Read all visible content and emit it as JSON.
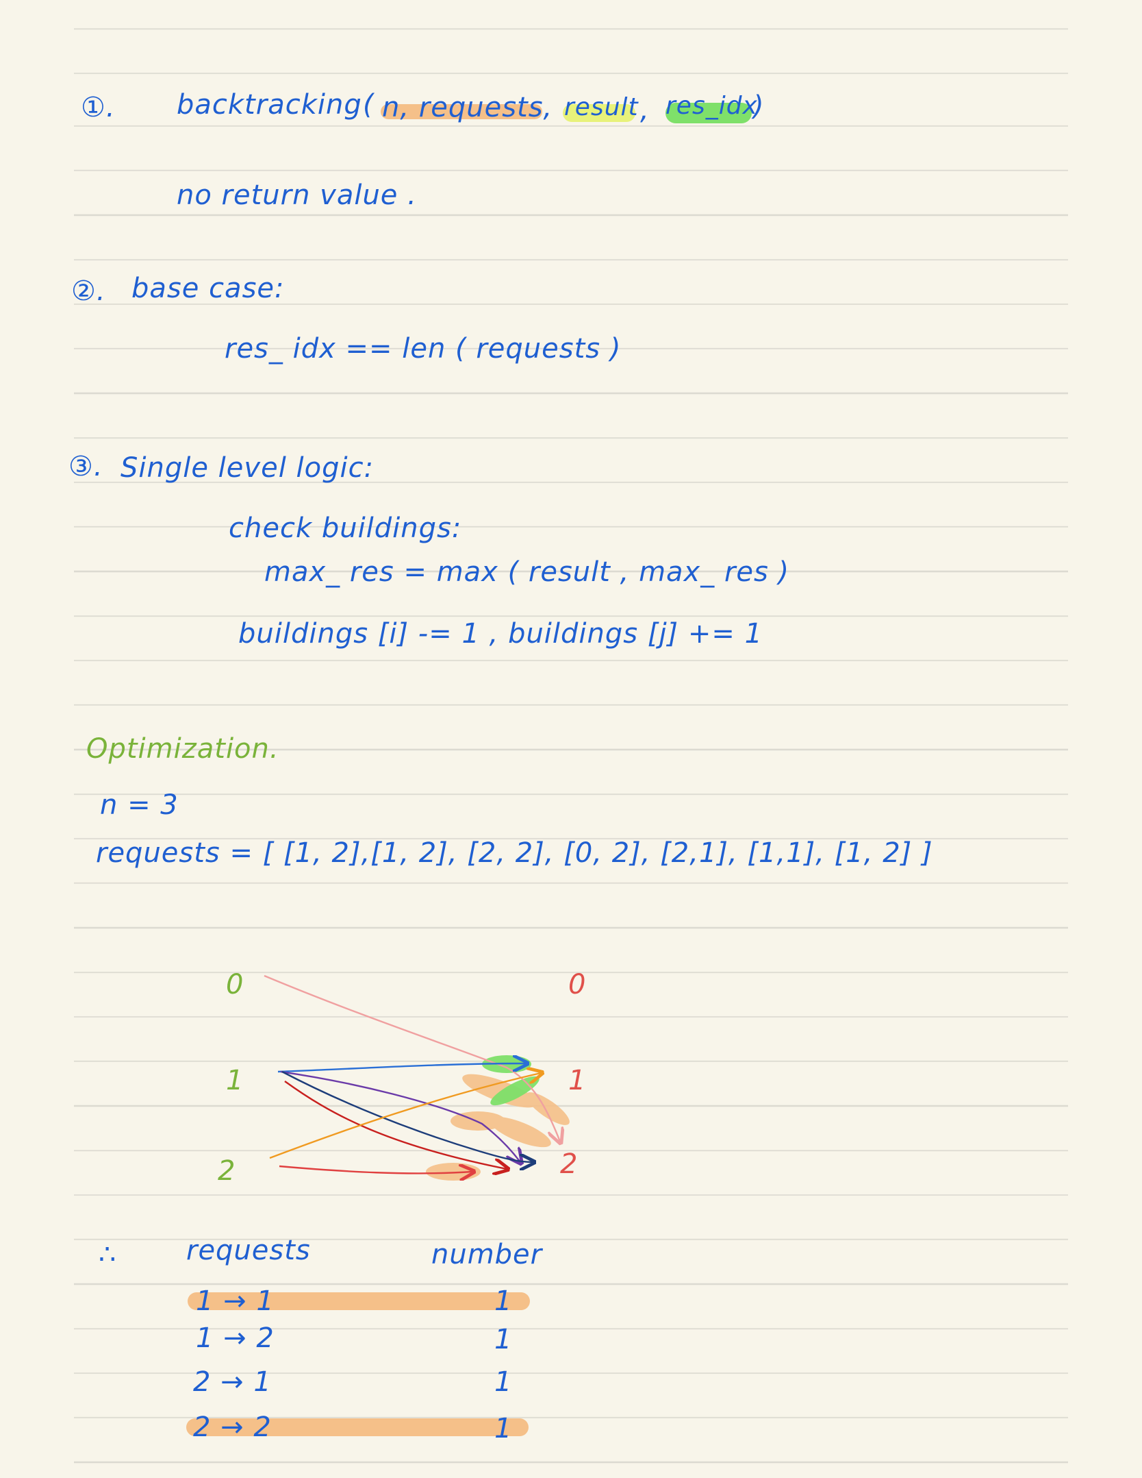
{
  "colors": {
    "ink_blue": "#1f5fd1",
    "ink_green": "#7ab33a",
    "ink_red": "#e0504a",
    "highlight_orange": "#f5c089",
    "highlight_green": "#7fe06a",
    "highlight_yellow": "#e8f27a",
    "paper": "#f8f5ea"
  },
  "section1": {
    "number": "①.",
    "signature_fn": "backtracking",
    "signature_open": "(",
    "signature_args1": "n, requests,",
    "signature_result": "result",
    "signature_comma": ",",
    "signature_residx": "res_idx",
    "signature_close": ")",
    "note": "no return   value ."
  },
  "section2": {
    "number": "②.",
    "title": "base   case:",
    "condition": "res_ idx  ==  len ( requests )"
  },
  "section3": {
    "number": "③.",
    "title": "Single  level  logic:",
    "step1": "check  buildings:",
    "step2": "max_ res    =  max ( result ,  max_ res )",
    "step3": "buildings [i] -= 1 ,  buildings [j] += 1"
  },
  "optimization": {
    "title": "Optimization.",
    "n_line": "n = 3",
    "requests_line": "requests = [ [1, 2],[1, 2], [2, 2], [0, 2], [2,1], [1,1], [1, 2] ]"
  },
  "diagram": {
    "left_labels": [
      "0",
      "1",
      "2"
    ],
    "right_labels": [
      "0",
      "1",
      "2"
    ]
  },
  "summary": {
    "therefore": "∴",
    "col_requests": "requests",
    "col_number": "number",
    "rows": [
      {
        "request": "1 → 1",
        "number": "1",
        "highlight": true
      },
      {
        "request": "1 → 2",
        "number": "1",
        "highlight": false
      },
      {
        "request": "2 → 1",
        "number": "1",
        "highlight": false
      },
      {
        "request": "2 → 2",
        "number": "1",
        "highlight": true
      }
    ]
  }
}
